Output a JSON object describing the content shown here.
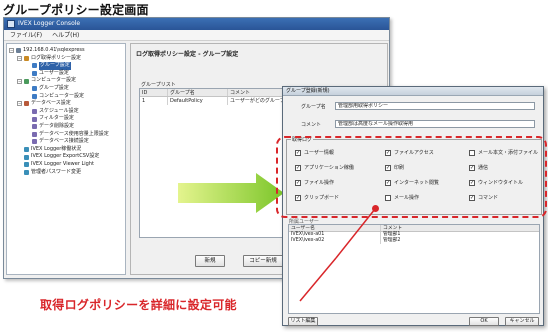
{
  "page": {
    "heading": "グループポリシー設定画面"
  },
  "main_window": {
    "title": "IVEX Logger Console",
    "menu": [
      "ファイル(F)",
      "ヘルプ(H)"
    ],
    "tree": [
      {
        "label": "192.168.0.41\\sqlexpress",
        "indent": 0,
        "exp": "−",
        "color": "#6b7f96"
      },
      {
        "label": "ログ取得ポリシー設定",
        "indent": 1,
        "exp": "−",
        "color": "#c98a25"
      },
      {
        "label": "グループ設定",
        "indent": 2,
        "exp": "",
        "color": "#3d7bc4",
        "selected": true
      },
      {
        "label": "ユーザー設定",
        "indent": 2,
        "exp": "",
        "color": "#3d7bc4"
      },
      {
        "label": "コンピューター設定",
        "indent": 1,
        "exp": "−",
        "color": "#4a9a5c"
      },
      {
        "label": "グループ設定",
        "indent": 2,
        "exp": "",
        "color": "#3d7bc4"
      },
      {
        "label": "コンピューター設定",
        "indent": 2,
        "exp": "",
        "color": "#3d7bc4"
      },
      {
        "label": "データベース設定",
        "indent": 1,
        "exp": "−",
        "color": "#b85a3a"
      },
      {
        "label": "スケジュール設定",
        "indent": 2,
        "exp": "",
        "color": "#7a6bb0"
      },
      {
        "label": "フィルター設定",
        "indent": 2,
        "exp": "",
        "color": "#7a6bb0"
      },
      {
        "label": "データ削除設定",
        "indent": 2,
        "exp": "",
        "color": "#7a6bb0"
      },
      {
        "label": "データベース使用容量上限設定",
        "indent": 2,
        "exp": "",
        "color": "#7a6bb0"
      },
      {
        "label": "データベース接続設定",
        "indent": 2,
        "exp": "",
        "color": "#7a6bb0"
      },
      {
        "label": "IVEX Logger稼働状況",
        "indent": 1,
        "exp": "",
        "color": "#3a8fb8"
      },
      {
        "label": "IVEX Logger ExportCSV設定",
        "indent": 1,
        "exp": "",
        "color": "#3a8fb8"
      },
      {
        "label": "IVEX Logger Viewer Light",
        "indent": 1,
        "exp": "",
        "color": "#3a8fb8"
      },
      {
        "label": "管理者パスワード変更",
        "indent": 1,
        "exp": "",
        "color": "#3a8fb8"
      }
    ],
    "pane_header": "ログ取得ポリシー設定 - グループ設定",
    "group_list_label": "グループリスト",
    "group_table": {
      "columns": [
        "ID",
        "グループ名",
        "コメント"
      ],
      "rows": [
        [
          "1",
          "DefaultPolicy",
          "ユーザーがどのグループにも所属していない場合、本ポ"
        ]
      ]
    },
    "new_button": "新規",
    "copy_new_button": "コピー新規"
  },
  "dialog": {
    "title": "グループ登録(新規)",
    "group_name_label": "グループ名",
    "group_name_value": "管理部用取得ポリシー",
    "comment_label": "コメント",
    "comment_value": "管理部は高度なメール操作取得用",
    "target_title": "取得ログ",
    "checkboxes": [
      {
        "label": "ユーザー情報",
        "checked": true
      },
      {
        "label": "ファイルアクセス",
        "checked": true
      },
      {
        "label": "メール本文・添付ファイル",
        "checked": false
      },
      {
        "label": "アプリケーション稼働",
        "checked": true
      },
      {
        "label": "印刷",
        "checked": true
      },
      {
        "label": "通信",
        "checked": true
      },
      {
        "label": "ファイル操作",
        "checked": true
      },
      {
        "label": "インターネット閲覧",
        "checked": true
      },
      {
        "label": "ウィンドウタイトル",
        "checked": true
      },
      {
        "label": "クリップボード",
        "checked": true
      },
      {
        "label": "メール操作",
        "checked": false
      },
      {
        "label": "コマンド",
        "checked": true
      }
    ],
    "user_list_label": "所属ユーザー",
    "user_table": {
      "columns": [
        "ユーザー名",
        "コメント"
      ],
      "rows": [
        [
          "IVEX\\ivex-a01",
          "管理部1"
        ],
        [
          "IVEX\\ivex-a02",
          "管理部2"
        ]
      ]
    },
    "list_edit_button": "リスト編集",
    "ok_button": "OK",
    "cancel_button": "キャンセル"
  },
  "annotation": {
    "caption": "取得ログポリシーを詳細に設定可能"
  },
  "colors": {
    "accent_red": "#d9262a",
    "arrow_green_start": "#d7ef7a",
    "arrow_green_end": "#7cc62a",
    "title_blue": "#2a5597"
  }
}
